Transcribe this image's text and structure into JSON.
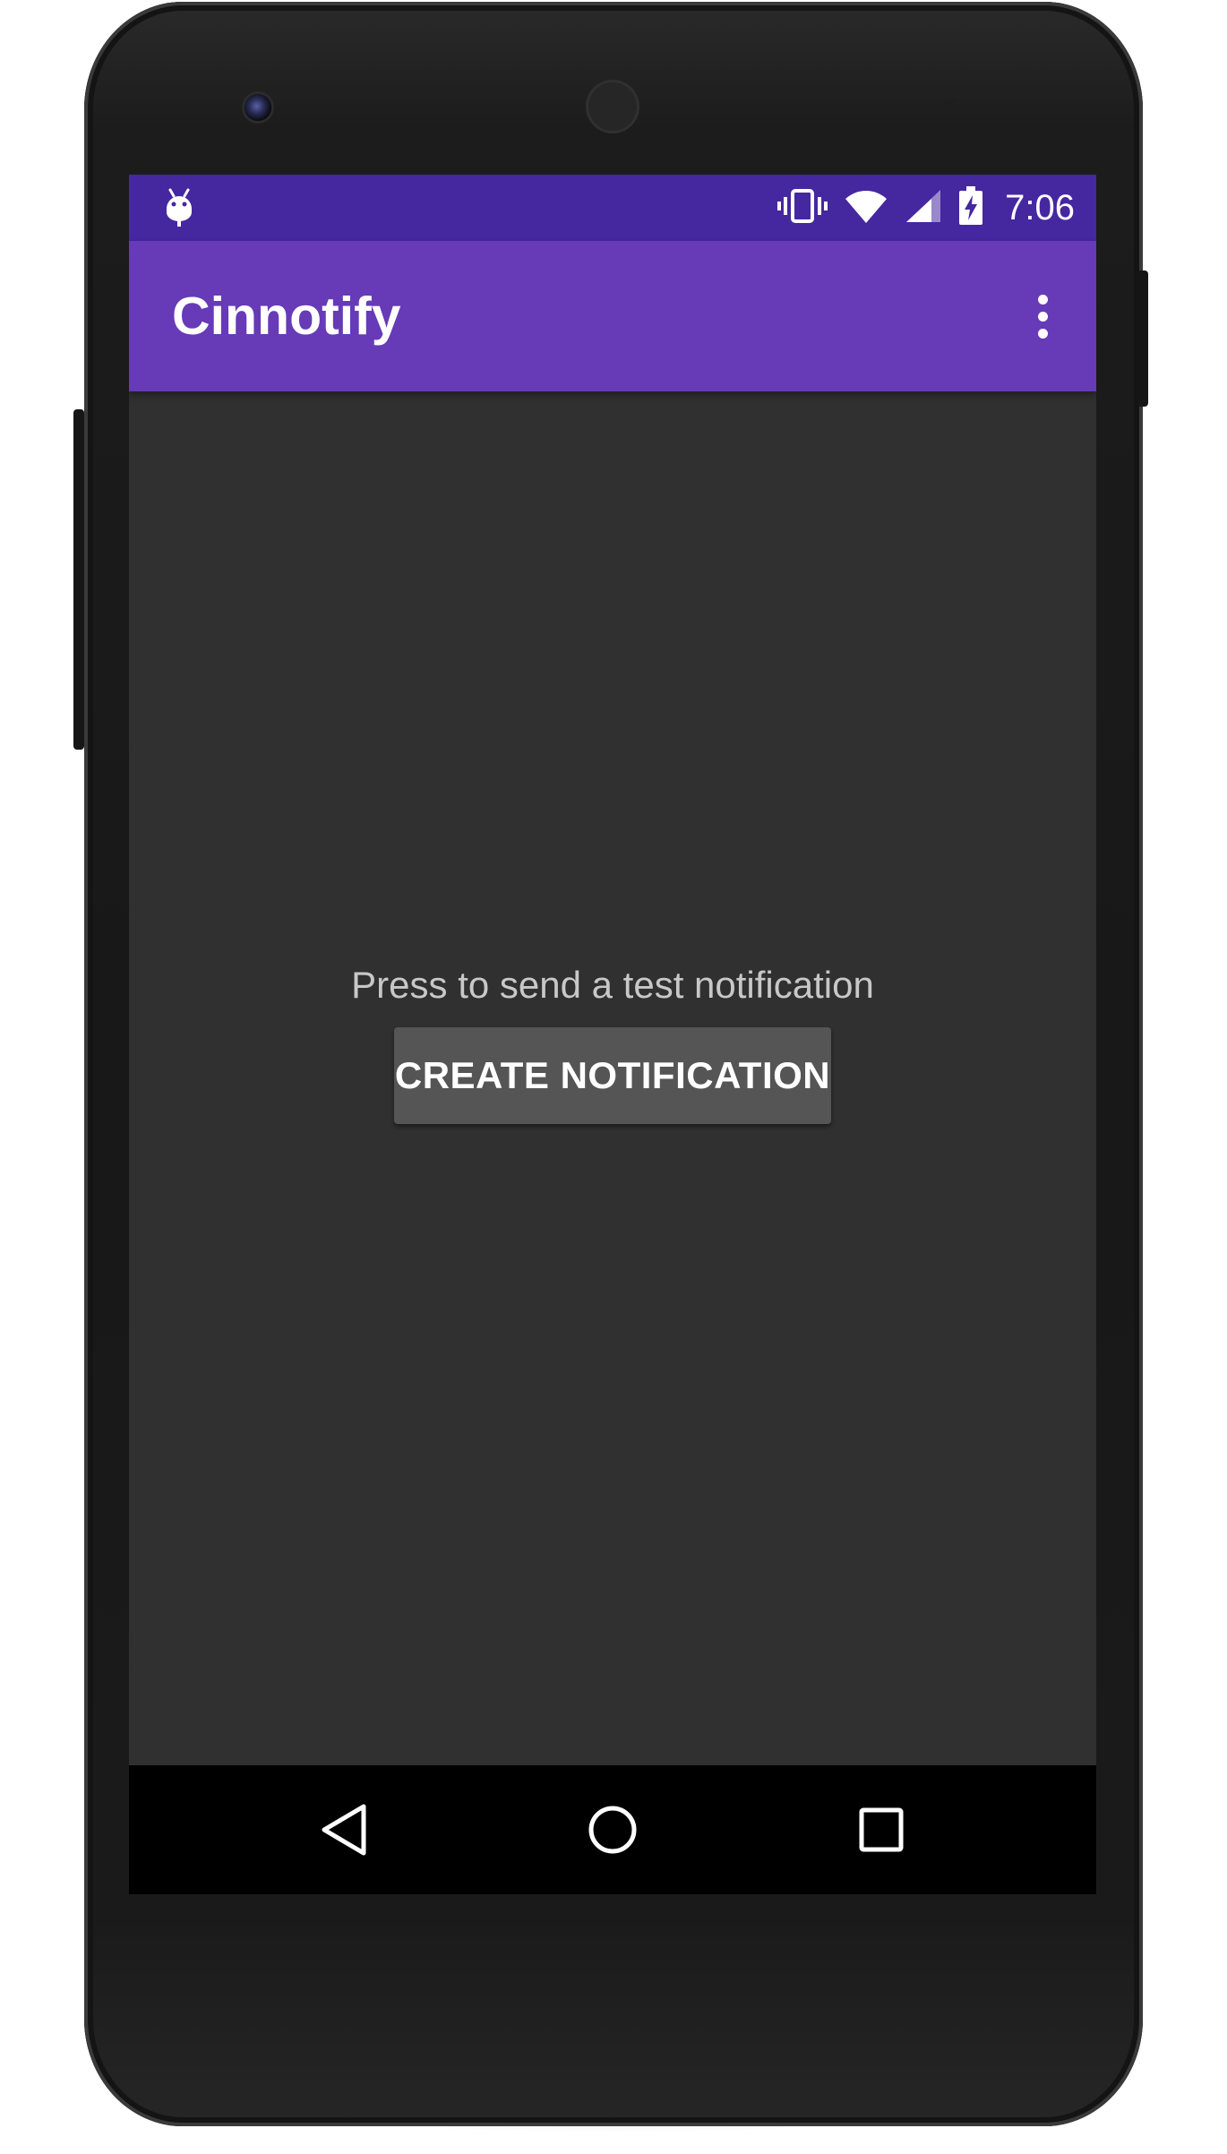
{
  "status_bar": {
    "time": "7:06",
    "icons": [
      "android-debug-icon",
      "vibrate-icon",
      "wifi-icon",
      "signal-icon",
      "battery-charging-icon"
    ]
  },
  "app_bar": {
    "title": "Cinnotify",
    "menu_icon": "overflow-menu-icon"
  },
  "main": {
    "prompt": "Press to send a test notification",
    "button_label": "CREATE NOTIFICATION"
  },
  "nav_bar": {
    "icons": [
      "back-icon",
      "home-icon",
      "recents-icon"
    ]
  },
  "colors": {
    "status_bar": "#4527a0",
    "app_bar": "#673ab7",
    "background": "#303030",
    "button": "#555555"
  }
}
